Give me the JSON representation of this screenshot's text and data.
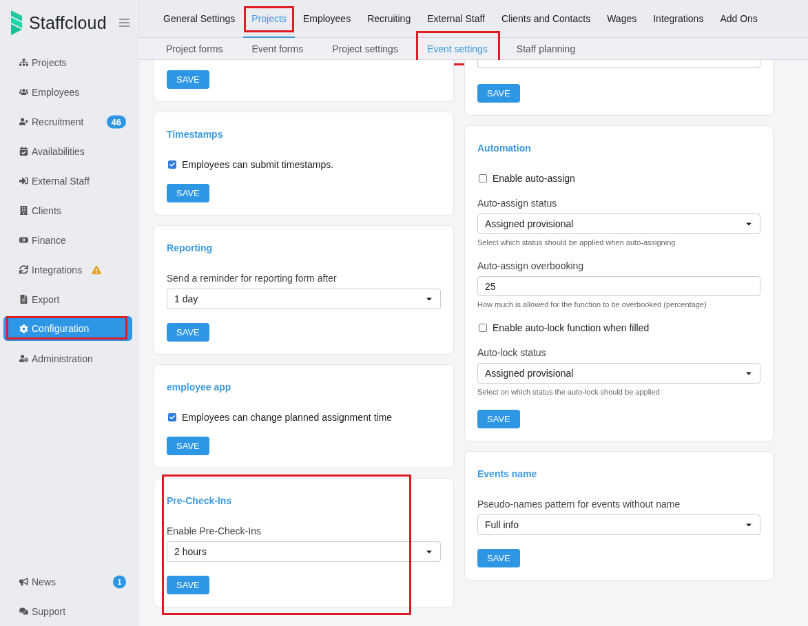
{
  "brand": {
    "name": "Staffcloud"
  },
  "sidebar": {
    "items": [
      {
        "label": "Projects",
        "selected": false,
        "annotated": false
      },
      {
        "label": "Employees",
        "selected": false,
        "annotated": false
      },
      {
        "label": "Recruitment",
        "selected": false,
        "annotated": false,
        "badge": "46"
      },
      {
        "label": "Availabilities",
        "selected": false,
        "annotated": false
      },
      {
        "label": "External Staff",
        "selected": false,
        "annotated": false
      },
      {
        "label": "Clients",
        "selected": false,
        "annotated": false
      },
      {
        "label": "Finance",
        "selected": false,
        "annotated": false
      },
      {
        "label": "Integrations",
        "selected": false,
        "annotated": false,
        "warning": true
      },
      {
        "label": "Export",
        "selected": false,
        "annotated": false
      },
      {
        "label": "Configuration",
        "selected": true,
        "annotated": true
      },
      {
        "label": "Administration",
        "selected": false,
        "annotated": false
      }
    ],
    "footer_items": [
      {
        "label": "News",
        "badge": "1"
      },
      {
        "label": "Support"
      }
    ]
  },
  "tabs": [
    {
      "label": "General Settings",
      "selected": false,
      "annotated": false
    },
    {
      "label": "Projects",
      "selected": true,
      "annotated": true
    },
    {
      "label": "Employees",
      "selected": false,
      "annotated": false
    },
    {
      "label": "Recruiting",
      "selected": false,
      "annotated": false
    },
    {
      "label": "External Staff",
      "selected": false,
      "annotated": false
    },
    {
      "label": "Clients and Contacts",
      "selected": false,
      "annotated": false
    },
    {
      "label": "Wages",
      "selected": false,
      "annotated": false
    },
    {
      "label": "Integrations",
      "selected": false,
      "annotated": false
    },
    {
      "label": "Add Ons",
      "selected": false,
      "annotated": false
    }
  ],
  "subtabs": [
    {
      "label": "Project forms",
      "selected": false,
      "annotated": false
    },
    {
      "label": "Event forms",
      "selected": false,
      "annotated": false
    },
    {
      "label": "Project settings",
      "selected": false,
      "annotated": false
    },
    {
      "label": "Event settings",
      "selected": true,
      "annotated": true
    },
    {
      "label": "Staff planning",
      "selected": false,
      "annotated": false
    }
  ],
  "left_cards": [
    {
      "clipped": true,
      "annotated": false,
      "button": "SAVE"
    },
    {
      "clipped": false,
      "annotated": false,
      "title": "Timestamps",
      "fields": [
        {
          "kind": "checkbox",
          "label": "Employees can submit timestamps.",
          "checked": true
        }
      ],
      "button": "SAVE"
    },
    {
      "clipped": false,
      "annotated": false,
      "title": "Reporting",
      "fields": [
        {
          "kind": "select",
          "label": "Send a reminder for reporting form after",
          "value": "1 day"
        }
      ],
      "button": "SAVE"
    },
    {
      "clipped": false,
      "annotated": false,
      "title": "employee app",
      "fields": [
        {
          "kind": "checkbox",
          "label": "Employees can change planned assignment time",
          "checked": true
        }
      ],
      "button": "SAVE"
    },
    {
      "clipped": false,
      "annotated": true,
      "title": "Pre-Check-Ins",
      "fields": [
        {
          "kind": "select",
          "label": "Enable Pre-Check-Ins",
          "value": "2 hours"
        }
      ],
      "button": "SAVE"
    }
  ],
  "right_cards": [
    {
      "clipped": true,
      "annotated": false,
      "fields": [
        {
          "kind": "select"
        }
      ],
      "button": "SAVE"
    },
    {
      "clipped": false,
      "annotated": false,
      "title": "Automation",
      "fields": [
        {
          "kind": "checkbox",
          "label": "Enable auto-assign",
          "checked": false
        },
        {
          "kind": "select",
          "label": "Auto-assign status",
          "value": "Assigned provisional",
          "help": "Select which status should be applied when auto-assigning"
        },
        {
          "kind": "input",
          "label": "Auto-assign overbooking",
          "value": "25",
          "help": "How much is allowed for the function to be overbooked (percentage)"
        },
        {
          "kind": "checkbox",
          "label": "Enable auto-lock function when filled",
          "checked": false
        },
        {
          "kind": "select",
          "label": "Auto-lock status",
          "value": "Assigned provisional",
          "help": "Select on which status the auto-lock should be applied"
        }
      ],
      "button": "SAVE"
    },
    {
      "clipped": false,
      "annotated": false,
      "title": "Events name",
      "fields": [
        {
          "kind": "select",
          "label": "Pseudo-names pattern for events without name",
          "value": "Full info"
        }
      ],
      "button": "SAVE"
    }
  ]
}
